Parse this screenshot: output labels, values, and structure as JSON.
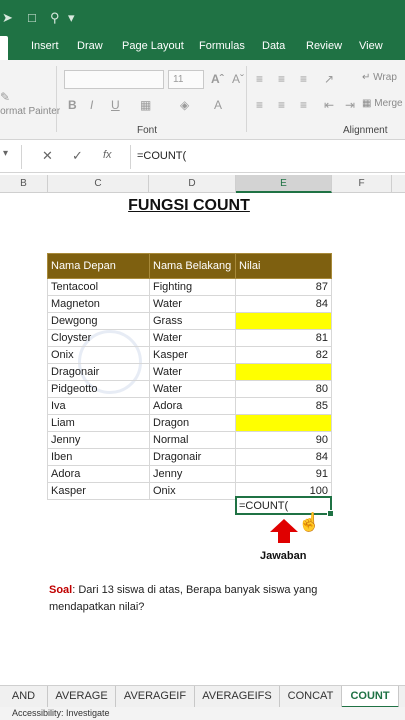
{
  "ribbon_tabs": [
    "Insert",
    "Draw",
    "Page Layout",
    "Formulas",
    "Data",
    "Review",
    "View"
  ],
  "ribbon": {
    "font_size": "11",
    "format_painter": "Format Painter",
    "wrap_text": "Wrap",
    "merge": "Merge",
    "font_group": "Font",
    "alignment_group": "Alignment",
    "bold": "B",
    "italic": "I",
    "underline": "U"
  },
  "formula_bar": {
    "fx": "fx",
    "value": "=COUNT("
  },
  "columns": [
    "B",
    "C",
    "D",
    "E",
    "F"
  ],
  "sheet": {
    "title": "FUNGSI COUNT",
    "headers": [
      "Nama Depan",
      "Nama Belakang",
      "Nilai"
    ],
    "rows": [
      {
        "first": "Tentacool",
        "last": "Fighting",
        "score": "87"
      },
      {
        "first": "Magneton",
        "last": "Water",
        "score": "84"
      },
      {
        "first": "Dewgong",
        "last": "Grass",
        "score": ""
      },
      {
        "first": "Cloyster",
        "last": "Water",
        "score": "81"
      },
      {
        "first": "Onix",
        "last": "Kasper",
        "score": "82"
      },
      {
        "first": "Dragonair",
        "last": "Water",
        "score": ""
      },
      {
        "first": "Pidgeotto",
        "last": "Water",
        "score": "80"
      },
      {
        "first": "Iva",
        "last": "Adora",
        "score": "85"
      },
      {
        "first": "Liam",
        "last": "Dragon",
        "score": ""
      },
      {
        "first": "Jenny",
        "last": "Normal",
        "score": "90"
      },
      {
        "first": "Iben",
        "last": "Dragonair",
        "score": "84"
      },
      {
        "first": "Adora",
        "last": "Jenny",
        "score": "91"
      },
      {
        "first": "Kasper",
        "last": "Onix",
        "score": "100"
      }
    ],
    "active_cell_value": "=COUNT(",
    "answer_label": "Jawaban",
    "question_label": "Soal",
    "question_text": ": Dari 13 siswa di atas, Berapa banyak siswa yang mendapatkan nilai?"
  },
  "sheet_tabs": [
    "AND",
    "AVERAGE",
    "AVERAGEIF",
    "AVERAGEIFS",
    "CONCAT",
    "COUNT"
  ],
  "active_sheet_tab": "COUNT",
  "status": "Accessibility: Investigate",
  "colors": {
    "excel_green": "#1f7244",
    "header_fill": "#7e6010",
    "empty_fill": "#ffff00",
    "arrow_red": "#e00000"
  }
}
